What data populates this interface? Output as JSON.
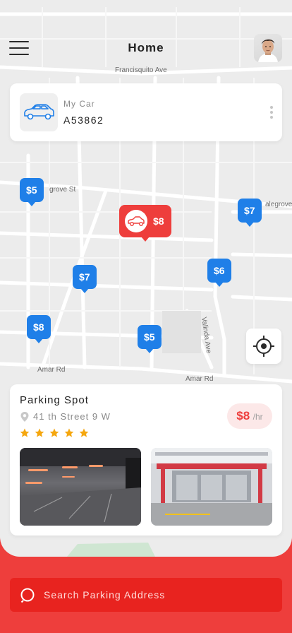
{
  "header": {
    "title": "Home",
    "menu_icon": "hamburger-menu-icon",
    "avatar_icon": "user-avatar"
  },
  "map": {
    "street_labels": [
      "Francisquito Ave",
      "Valinda Ave",
      "Amar Rd",
      "Amar Rd",
      "grove St",
      "alegrove"
    ]
  },
  "car_card": {
    "label": "My Car",
    "plate": "A53862",
    "icon": "car-icon"
  },
  "pins": [
    {
      "label": "$5"
    },
    {
      "label": "$8",
      "selected": true
    },
    {
      "label": "$7"
    },
    {
      "label": "$7"
    },
    {
      "label": "$6"
    },
    {
      "label": "$8"
    },
    {
      "label": "$5"
    }
  ],
  "spot": {
    "title": "Parking Spot",
    "address": "41 th Street 9 W",
    "rating": 5,
    "price": "$8",
    "unit": "/hr"
  },
  "search": {
    "placeholder": "Search Parking Address"
  },
  "colors": {
    "accent_red": "#ee3e3c",
    "pin_blue": "#1f7fe8",
    "star_orange": "#f5a70f"
  }
}
